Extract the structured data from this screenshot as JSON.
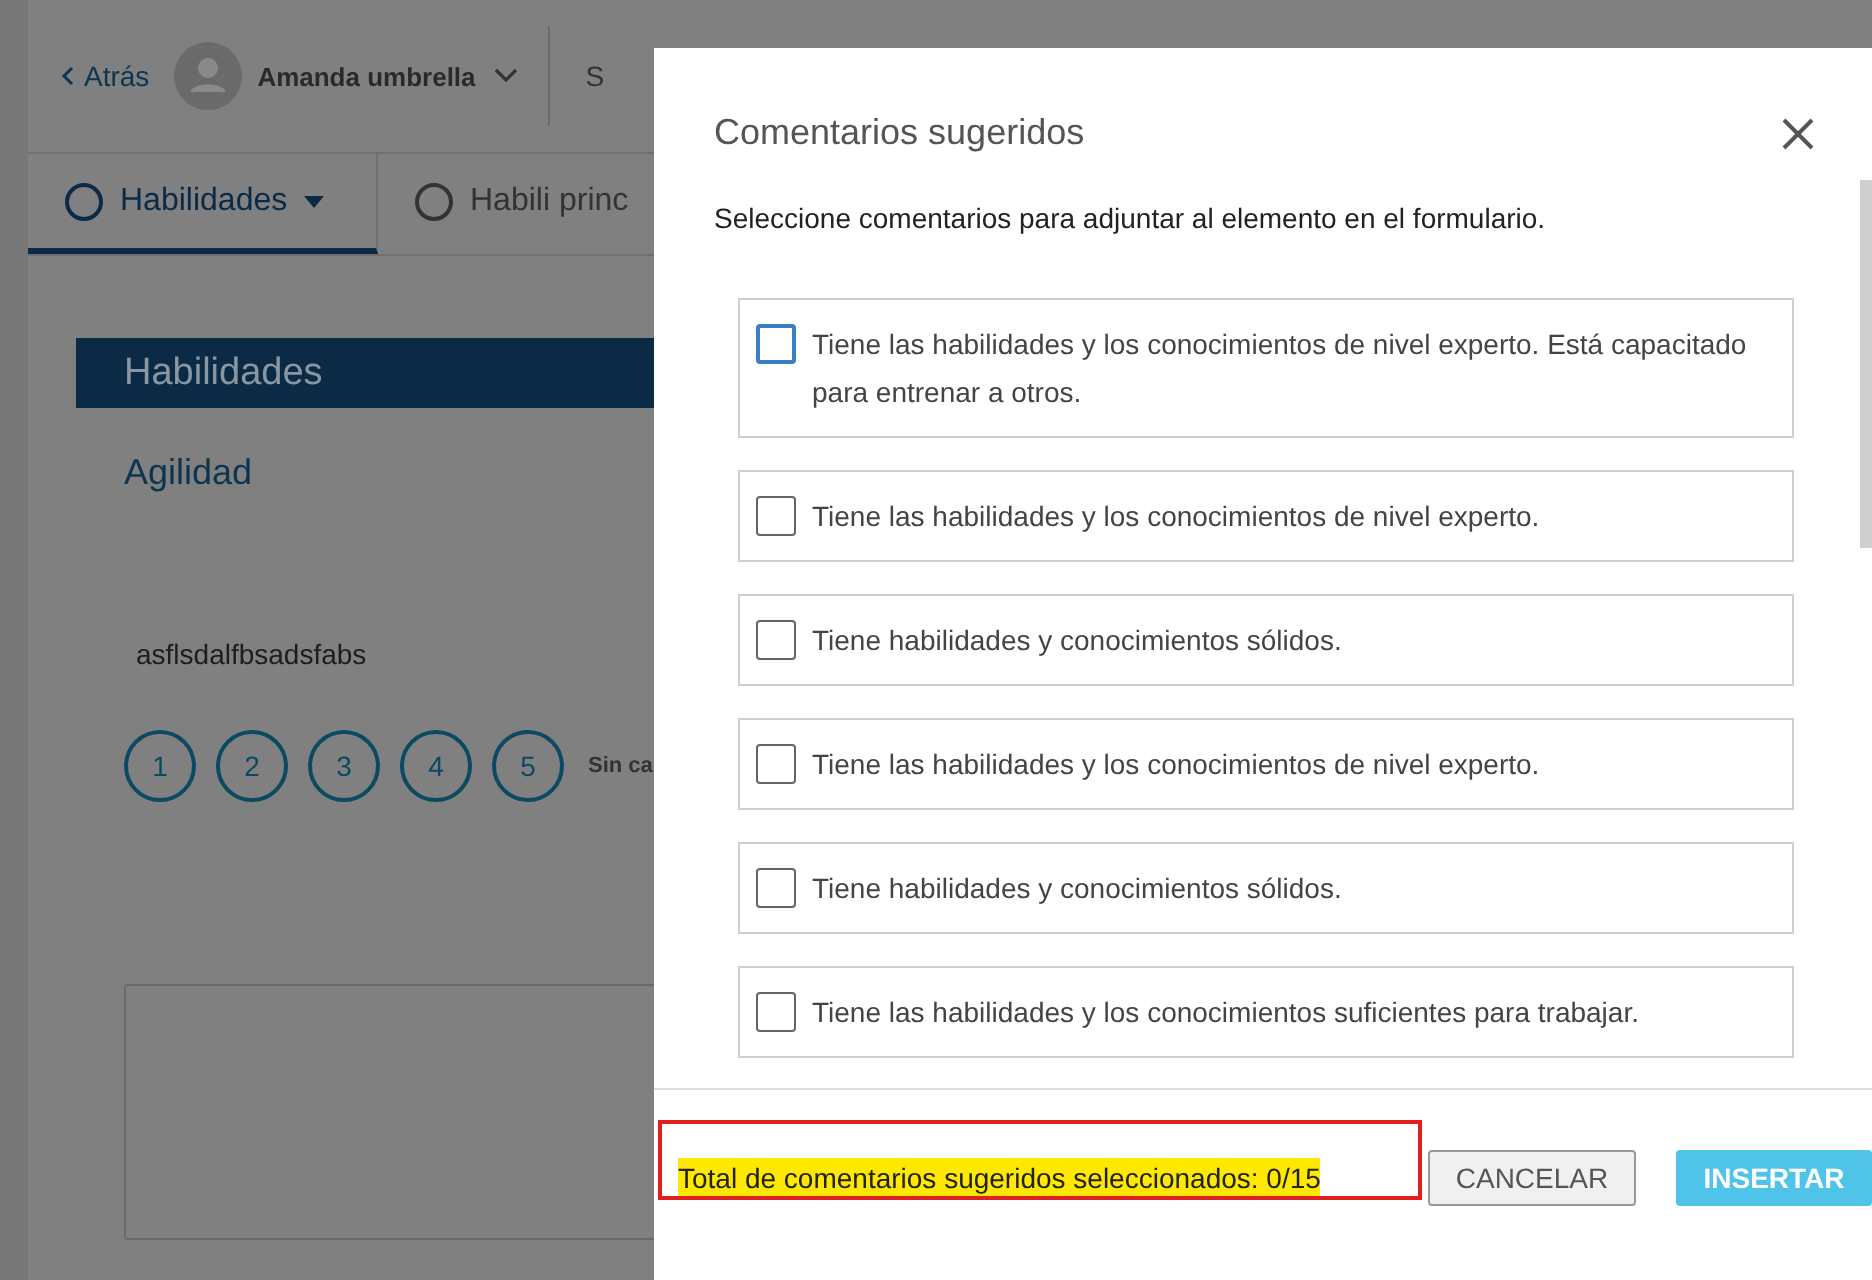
{
  "header": {
    "back": "Atrás",
    "user": "Amanda umbrella",
    "cut_label": "S"
  },
  "tabs": [
    {
      "label": "Habilidades",
      "selected": true,
      "dropdown": true
    },
    {
      "label": "Habili princ",
      "selected": false,
      "dropdown": false
    }
  ],
  "section": {
    "title": "Habilidades",
    "item": "Agilidad",
    "comment": "asflsdalfbsadsfabs",
    "ratings": [
      "1",
      "2",
      "3",
      "4",
      "5"
    ],
    "rating_note": "Sin ca"
  },
  "dialog": {
    "title": "Comentarios sugeridos",
    "subtitle": "Seleccione comentarios para adjuntar al elemento en el formulario.",
    "comments": [
      {
        "text": "Tiene las habilidades y los conocimientos de nivel experto. Está capacitado para entrenar a otros.",
        "checked": false,
        "focused": true
      },
      {
        "text": "Tiene las habilidades y los conocimientos de nivel experto.",
        "checked": false,
        "focused": false
      },
      {
        "text": "Tiene habilidades y conocimientos sólidos.",
        "checked": false,
        "focused": false
      },
      {
        "text": "Tiene las habilidades y los conocimientos de nivel experto.",
        "checked": false,
        "focused": false
      },
      {
        "text": "Tiene habilidades y conocimientos sólidos.",
        "checked": false,
        "focused": false
      },
      {
        "text": "Tiene las habilidades y los conocimientos suficientes para trabajar.",
        "checked": false,
        "focused": false
      }
    ],
    "total": "Total de comentarios sugeridos seleccionados: 0/15",
    "buttons": [
      {
        "label": "CANCELAR",
        "kind": "secondary"
      },
      {
        "label": "INSERTAR",
        "kind": "primary"
      }
    ]
  }
}
